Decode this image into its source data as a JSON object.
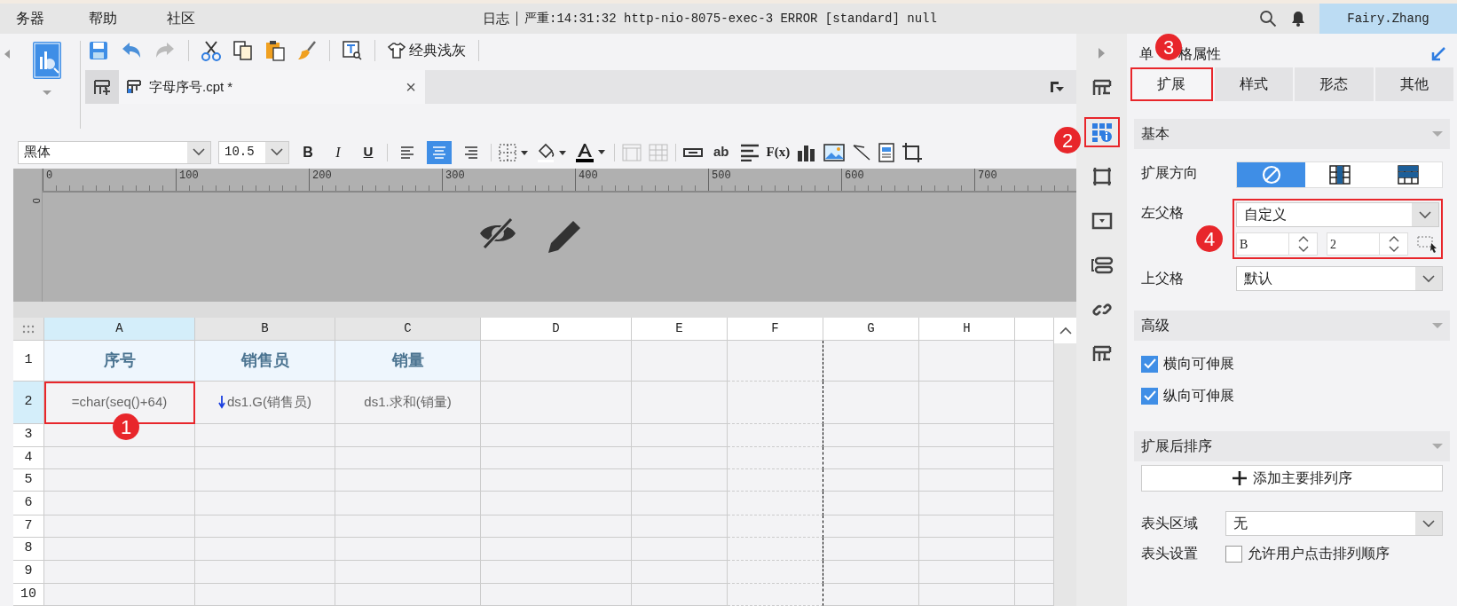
{
  "menu_bar": {
    "items": [
      "务器",
      "帮助",
      "社区"
    ],
    "log_label": "日志",
    "log_message": "严重:14:31:32 http-nio-8075-exec-3 ERROR [standard] null",
    "user": "Fairy.Zhang"
  },
  "toolbar": {
    "theme_button": "经典浅灰"
  },
  "file_tab": {
    "title": "字母序号.cpt *",
    "close": "×"
  },
  "format_bar": {
    "font": "黑体",
    "size": "10.5",
    "bold": "B",
    "italic": "I",
    "underline": "U",
    "align": [
      {
        "kind": "left",
        "selected": false
      },
      {
        "kind": "center",
        "selected": true
      },
      {
        "kind": "right",
        "selected": false
      }
    ],
    "text_tool": "ab",
    "formula_tool": "F(x)"
  },
  "ruler": {
    "vertical_tick": "0",
    "ticks": [
      "0",
      "100",
      "200",
      "300",
      "400",
      "500",
      "600",
      "700"
    ]
  },
  "sheet": {
    "columns": [
      {
        "label": "A",
        "selected": true
      },
      {
        "label": "B",
        "selected": false
      },
      {
        "label": "C",
        "selected": false
      },
      {
        "label": "D",
        "selected": false
      },
      {
        "label": "E",
        "selected": false
      },
      {
        "label": "F",
        "selected": false
      },
      {
        "label": "G",
        "selected": false
      },
      {
        "label": "H",
        "selected": false
      }
    ],
    "rows": [
      {
        "label": "1",
        "kind": "header",
        "selected": false,
        "cells": [
          "序号",
          "销售员",
          "销量"
        ]
      },
      {
        "label": "2",
        "kind": "data",
        "selected": true,
        "cells": [
          "=char(seq()+64)",
          "ds1.G(销售员)",
          "ds1.求和(销量)"
        ]
      },
      {
        "label": "3",
        "kind": "empty",
        "selected": false
      },
      {
        "label": "4",
        "kind": "empty",
        "selected": false
      },
      {
        "label": "5",
        "kind": "empty",
        "selected": false
      },
      {
        "label": "6",
        "kind": "empty",
        "selected": false
      },
      {
        "label": "7",
        "kind": "empty",
        "selected": false
      },
      {
        "label": "8",
        "kind": "empty",
        "selected": false
      },
      {
        "label": "9",
        "kind": "empty",
        "selected": false
      },
      {
        "label": "10",
        "kind": "empty",
        "selected": false
      }
    ]
  },
  "side_icons": [
    {
      "kind": "template",
      "selected": false
    },
    {
      "kind": "cell-attr",
      "selected": true
    },
    {
      "kind": "frame",
      "selected": false
    },
    {
      "kind": "widget",
      "selected": false
    },
    {
      "kind": "condition",
      "selected": false
    },
    {
      "kind": "link",
      "selected": false
    },
    {
      "kind": "template",
      "selected": false
    }
  ],
  "panel": {
    "title_parts": [
      "单",
      "格属性"
    ],
    "tabs": [
      {
        "label": "扩展",
        "selected": true
      },
      {
        "label": "样式",
        "selected": false
      },
      {
        "label": "形态",
        "selected": false
      },
      {
        "label": "其他",
        "selected": false
      }
    ],
    "basic": {
      "heading": "基本",
      "direction_label": "扩展方向",
      "directions": [
        {
          "kind": "none",
          "selected": true
        },
        {
          "kind": "vertical",
          "selected": false
        },
        {
          "kind": "horizontal",
          "selected": false
        }
      ],
      "left_parent_label": "左父格",
      "left_parent": "自定义",
      "left_column": "B",
      "left_row": "2",
      "top_parent_label": "上父格",
      "top_parent": "默认"
    },
    "advanced": {
      "heading": "高级",
      "options": [
        {
          "label": "横向可伸展",
          "checked": true
        },
        {
          "label": "纵向可伸展",
          "checked": true
        }
      ]
    },
    "sort": {
      "heading": "扩展后排序",
      "add_button": "添加主要排列序",
      "header_area_label": "表头区域",
      "header_area": "无",
      "header_setting_label": "表头设置",
      "header_setting": {
        "label": "允许用户点击排列顺序",
        "checked": false
      }
    }
  },
  "annotations": [
    "1",
    "2",
    "3",
    "4"
  ]
}
